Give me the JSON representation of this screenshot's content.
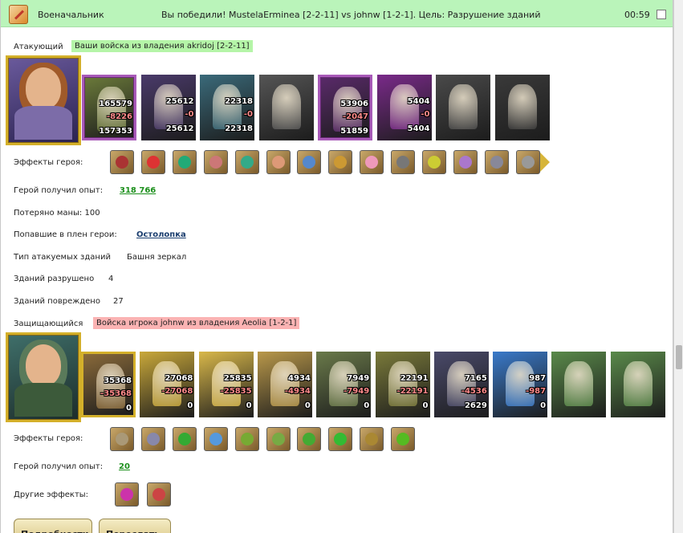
{
  "header": {
    "title": "Военачальник",
    "result": "Вы победили! MustelaErminea [2-2-11] vs johnw [1-2-1]. Цель: Разрушение зданий",
    "time": "00:59"
  },
  "attacker": {
    "label": "Атакующий",
    "army_tag": "Ваши войска из владения akridoj [2-2-11]",
    "units": [
      {
        "icon": "lizard-warrior",
        "count": "165579",
        "loss": "-8226",
        "remain": "157353",
        "color": "#6b7a3a",
        "selected": true
      },
      {
        "icon": "dark-elf-swordsman",
        "count": "25612",
        "loss": "-0",
        "remain": "25612",
        "color": "#4a3a6a"
      },
      {
        "icon": "dragon-knight",
        "count": "22318",
        "loss": "-0",
        "remain": "22318",
        "color": "#3a6a7a"
      },
      {
        "icon": "ghost-bird",
        "count": "",
        "loss": "",
        "remain": "",
        "color": "#555555"
      },
      {
        "icon": "skeleton-archer",
        "count": "53906",
        "loss": "-2047",
        "remain": "51859",
        "color": "#5a2a6a",
        "selected": true
      },
      {
        "icon": "dark-mage",
        "count": "5404",
        "loss": "-0",
        "remain": "5404",
        "color": "#7a2a8a"
      },
      {
        "icon": "shadow-wraith",
        "count": "",
        "loss": "",
        "remain": "",
        "color": "#4a4a4a"
      },
      {
        "icon": "spider-rider",
        "count": "",
        "loss": "",
        "remain": "",
        "color": "#3a3a3a"
      }
    ],
    "effects_label": "Эффекты героя:",
    "effects": [
      {
        "icon": "beast-skull-icon",
        "color": "#a33"
      },
      {
        "icon": "dice-icon",
        "color": "#d33"
      },
      {
        "icon": "shield-icon",
        "color": "#2a7"
      },
      {
        "icon": "handshake-icon",
        "color": "#c77"
      },
      {
        "icon": "sword-icon",
        "color": "#3a8"
      },
      {
        "icon": "handshake-icon",
        "color": "#d97"
      },
      {
        "icon": "crystal-hand-icon",
        "color": "#58c"
      },
      {
        "icon": "horn-icon",
        "color": "#c93"
      },
      {
        "icon": "leaf-icon",
        "color": "#e9b"
      },
      {
        "icon": "amulet-icon",
        "color": "#777"
      },
      {
        "icon": "armor-icon",
        "color": "#cc3"
      },
      {
        "icon": "ring-icon",
        "color": "#a7c"
      },
      {
        "icon": "gauntlet-icon",
        "color": "#889"
      },
      {
        "icon": "dagger-icon",
        "color": "#999"
      }
    ],
    "exp_label": "Герой получил опыт:",
    "exp_value": "318 766",
    "mana_text": "Потеряно маны: 100",
    "captured_label": "Попавшие в плен герои:",
    "captured_hero": "Остолопка",
    "target_label": "Тип атакуемых зданий",
    "target_value": "Башня зеркал",
    "destroyed_label": "Зданий разрушено",
    "destroyed_value": "4",
    "damaged_label": "Зданий повреждено",
    "damaged_value": "27"
  },
  "defender": {
    "label": "Защищающийся",
    "army_tag": "Войска игрока johnw из владения Aeolia [1-2-1]",
    "units": [
      {
        "icon": "dwarf-merchant",
        "count": "35368",
        "loss": "-35368",
        "remain": "0",
        "color": "#8a6a3a",
        "gold": true
      },
      {
        "icon": "sun-paladin",
        "count": "27068",
        "loss": "-27068",
        "remain": "0",
        "color": "#c9a83a"
      },
      {
        "icon": "griffin-knight",
        "count": "25835",
        "loss": "-25835",
        "remain": "0",
        "color": "#d9b84a"
      },
      {
        "icon": "pegasus-rider",
        "count": "4934",
        "loss": "-4934",
        "remain": "0",
        "color": "#b9984a"
      },
      {
        "icon": "crossbowman",
        "count": "7949",
        "loss": "-7949",
        "remain": "0",
        "color": "#6a7a4a"
      },
      {
        "icon": "hooded-priest",
        "count": "22191",
        "loss": "-22191",
        "remain": "0",
        "color": "#7a7a3a"
      },
      {
        "icon": "blade-master",
        "count": "7165",
        "loss": "-4536",
        "remain": "2629",
        "color": "#4a4a6a"
      },
      {
        "icon": "archmage",
        "count": "987",
        "loss": "-987",
        "remain": "0",
        "color": "#3a7aca"
      },
      {
        "icon": "crystal-tower",
        "count": "",
        "loss": "",
        "remain": "",
        "color": "#5a8a4a"
      },
      {
        "icon": "crystal-tower",
        "count": "",
        "loss": "",
        "remain": "",
        "color": "#5a8a4a"
      }
    ],
    "effects_label": "Эффекты героя:",
    "effects": [
      {
        "icon": "twin-masks-icon",
        "color": "#a97"
      },
      {
        "icon": "reel-icon",
        "color": "#88a"
      },
      {
        "icon": "leaf-blade-icon",
        "color": "#3a3"
      },
      {
        "icon": "star-burst-icon",
        "color": "#59d"
      },
      {
        "icon": "feather-icon",
        "color": "#7a3"
      },
      {
        "icon": "potion-rack-icon",
        "color": "#7a4"
      },
      {
        "icon": "vine-icon",
        "color": "#4a3"
      },
      {
        "icon": "clover-icon",
        "color": "#3b3"
      },
      {
        "icon": "bow-icon",
        "color": "#a83"
      },
      {
        "icon": "clover-gold-icon",
        "color": "#5b2"
      }
    ],
    "exp_label": "Герой получил опыт:",
    "exp_value": "20",
    "other_label": "Другие эффекты:",
    "other_effects": [
      {
        "icon": "jester-flag-icon",
        "color": "#c3a"
      },
      {
        "icon": "shield-crest-icon",
        "color": "#c44"
      }
    ]
  },
  "buttons": {
    "details": "Подробности",
    "forward": "Переслать"
  }
}
